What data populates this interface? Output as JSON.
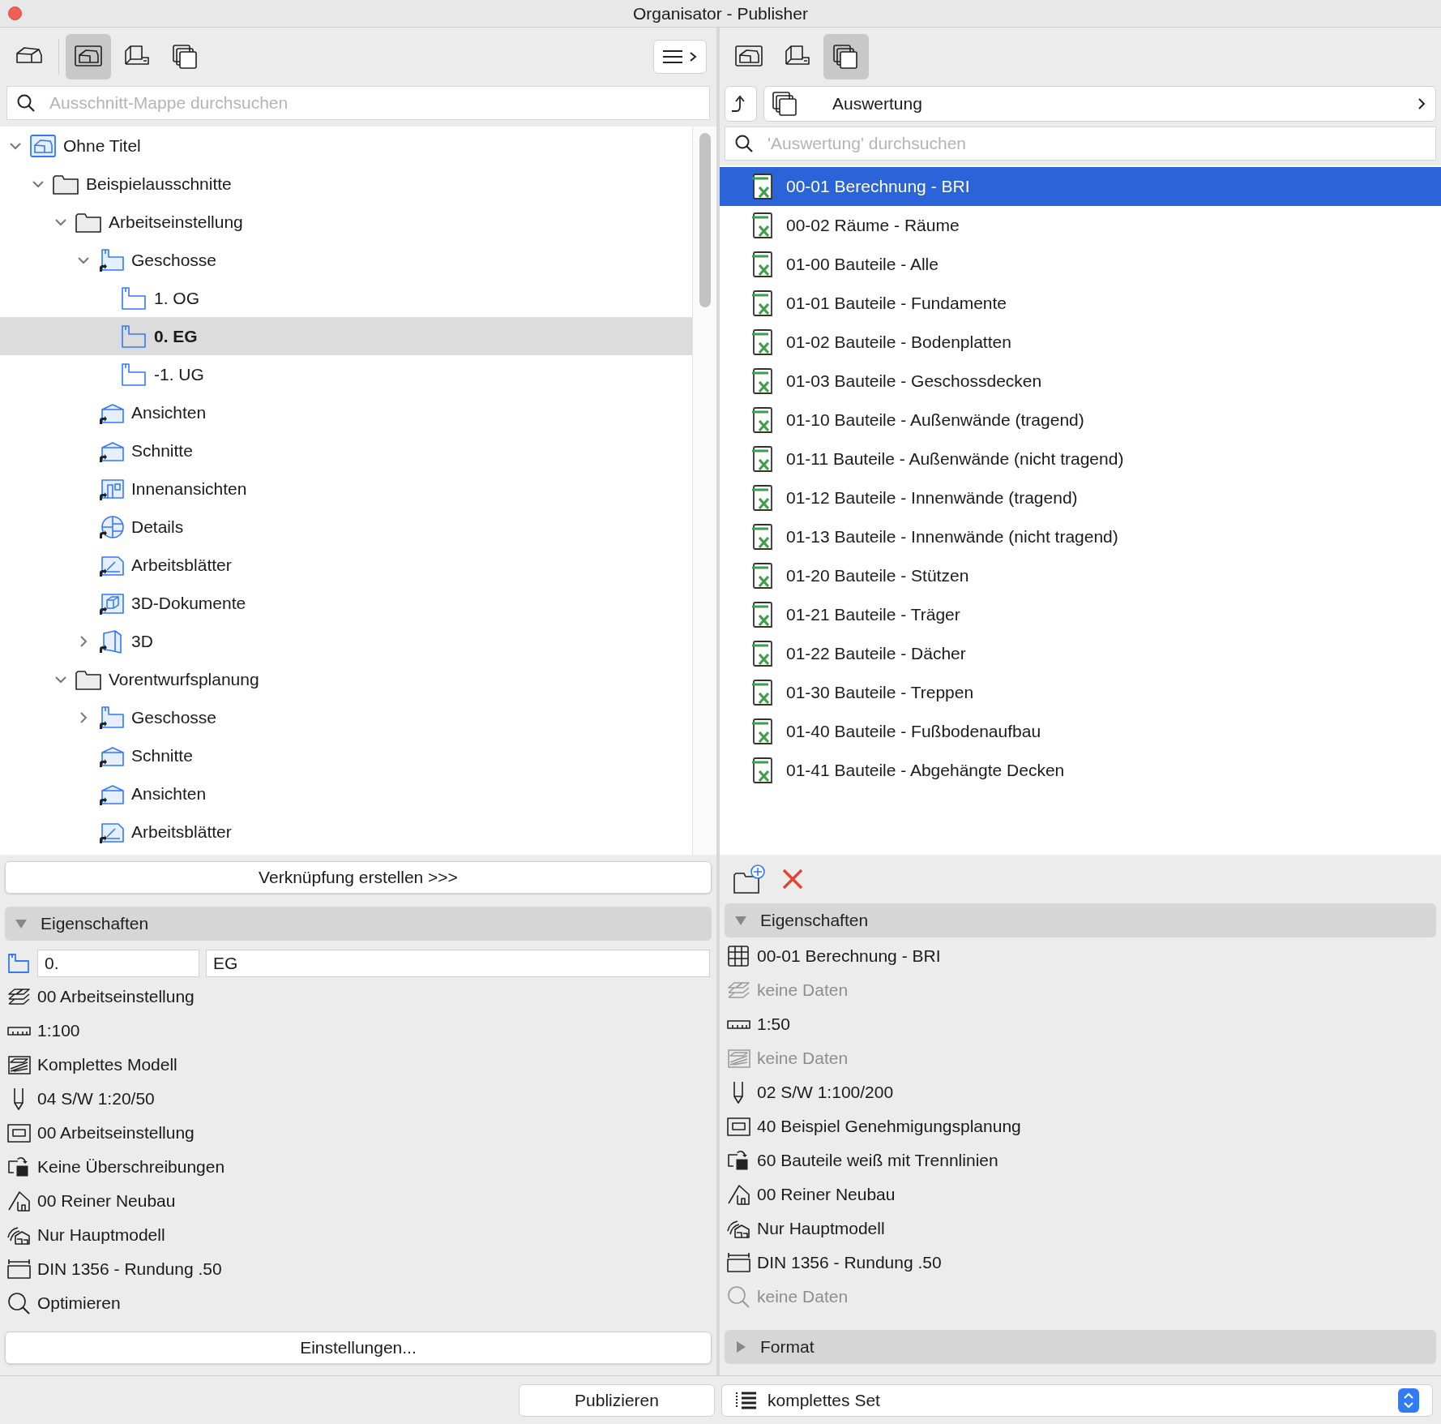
{
  "window": {
    "title": "Organisator - Publisher"
  },
  "left": {
    "toolbar": [
      {
        "kind": "project",
        "selected": false
      },
      {
        "kind": "views",
        "selected": true
      },
      {
        "kind": "layouts",
        "selected": false
      },
      {
        "kind": "sets",
        "selected": false
      }
    ],
    "search": {
      "placeholder": "Ausschnitt-Mappe durchsuchen"
    },
    "tree": [
      {
        "label": "Ohne Titel",
        "kind": "project",
        "expanded": true,
        "selected": false,
        "children": [
          {
            "label": "Beispielausschnitte",
            "kind": "folder",
            "expanded": true,
            "selected": false,
            "children": [
              {
                "label": "Arbeitseinstellung",
                "kind": "folder",
                "expanded": true,
                "selected": false,
                "children": [
                  {
                    "label": "Geschosse",
                    "kind": "stories",
                    "expanded": true,
                    "selected": false,
                    "children": [
                      {
                        "label": "1. OG",
                        "kind": "story",
                        "selected": false
                      },
                      {
                        "label": "0. EG",
                        "kind": "story",
                        "selected": true
                      },
                      {
                        "label": "-1. UG",
                        "kind": "story",
                        "selected": false
                      }
                    ]
                  },
                  {
                    "label": "Ansichten",
                    "kind": "elevations",
                    "selected": false
                  },
                  {
                    "label": "Schnitte",
                    "kind": "elevations",
                    "selected": false
                  },
                  {
                    "label": "Innenansichten",
                    "kind": "interior",
                    "selected": false
                  },
                  {
                    "label": "Details",
                    "kind": "details",
                    "selected": false
                  },
                  {
                    "label": "Arbeitsblätter",
                    "kind": "worksheets",
                    "selected": false
                  },
                  {
                    "label": "3D-Dokumente",
                    "kind": "documents3d",
                    "selected": false
                  },
                  {
                    "label": "3D",
                    "kind": "view3d",
                    "expanded": false,
                    "selected": false
                  }
                ]
              },
              {
                "label": "Vorentwurfsplanung",
                "kind": "folder",
                "expanded": true,
                "selected": false,
                "children": [
                  {
                    "label": "Geschosse",
                    "kind": "stories",
                    "expanded": false,
                    "selected": false
                  },
                  {
                    "label": "Schnitte",
                    "kind": "elevations",
                    "selected": false
                  },
                  {
                    "label": "Ansichten",
                    "kind": "elevations",
                    "selected": false
                  },
                  {
                    "label": "Arbeitsblätter",
                    "kind": "worksheets",
                    "selected": false
                  }
                ]
              }
            ]
          }
        ]
      }
    ],
    "link_button": "Verknüpfung erstellen >>>",
    "properties": {
      "title": "Eigenschaften",
      "expanded": true,
      "id_field": {
        "value": "0."
      },
      "name_field": {
        "value": "EG"
      },
      "rows": [
        {
          "kind": "layers",
          "text": "00 Arbeitseinstellung",
          "disabled": false
        },
        {
          "kind": "scale",
          "text": "1:100",
          "disabled": false
        },
        {
          "kind": "structure",
          "text": "Komplettes Modell",
          "disabled": false
        },
        {
          "kind": "pen",
          "text": "04 S/W 1:20/50",
          "disabled": false
        },
        {
          "kind": "mvo",
          "text": "00 Arbeitseinstellung",
          "disabled": false
        },
        {
          "kind": "override",
          "text": "Keine Überschreibungen",
          "disabled": false
        },
        {
          "kind": "renovation",
          "text": "00 Reiner Neubau",
          "disabled": false
        },
        {
          "kind": "model",
          "text": "Nur Hauptmodell",
          "disabled": false
        },
        {
          "kind": "dimension",
          "text": "DIN 1356 - Rundung .50",
          "disabled": false
        },
        {
          "kind": "zoom",
          "text": "Optimieren",
          "disabled": false
        }
      ]
    },
    "settings_button": "Einstellungen..."
  },
  "right": {
    "toolbar": [
      {
        "kind": "views",
        "selected": false
      },
      {
        "kind": "layouts",
        "selected": false
      },
      {
        "kind": "sets",
        "selected": true
      }
    ],
    "path": {
      "label": "Auswertung"
    },
    "search": {
      "placeholder": "'Auswertung' durchsuchen"
    },
    "items": [
      {
        "label": "00-01 Berechnung - BRI",
        "selected": true
      },
      {
        "label": "00-02 Räume - Räume",
        "selected": false
      },
      {
        "label": "01-00 Bauteile - Alle",
        "selected": false
      },
      {
        "label": "01-01 Bauteile - Fundamente",
        "selected": false
      },
      {
        "label": "01-02 Bauteile - Bodenplatten",
        "selected": false
      },
      {
        "label": "01-03 Bauteile - Geschossdecken",
        "selected": false
      },
      {
        "label": "01-10 Bauteile - Außenwände (tragend)",
        "selected": false
      },
      {
        "label": "01-11 Bauteile - Außenwände (nicht tragend)",
        "selected": false
      },
      {
        "label": "01-12 Bauteile - Innenwände (tragend)",
        "selected": false
      },
      {
        "label": "01-13 Bauteile - Innenwände (nicht tragend)",
        "selected": false
      },
      {
        "label": "01-20 Bauteile - Stützen",
        "selected": false
      },
      {
        "label": "01-21 Bauteile - Träger",
        "selected": false
      },
      {
        "label": "01-22 Bauteile - Dächer",
        "selected": false
      },
      {
        "label": "01-30 Bauteile - Treppen",
        "selected": false
      },
      {
        "label": "01-40 Bauteile - Fußbodenaufbau",
        "selected": false
      },
      {
        "label": "01-41 Bauteile - Abgehängte Decken",
        "selected": false
      }
    ],
    "properties": {
      "title": "Eigenschaften",
      "expanded": true,
      "rows": [
        {
          "kind": "table",
          "text": "00-01 Berechnung - BRI",
          "disabled": false
        },
        {
          "kind": "layers",
          "text": "keine Daten",
          "disabled": true
        },
        {
          "kind": "scale",
          "text": "1:50",
          "disabled": false
        },
        {
          "kind": "structure",
          "text": "keine Daten",
          "disabled": true
        },
        {
          "kind": "pen",
          "text": "02 S/W 1:100/200",
          "disabled": false
        },
        {
          "kind": "mvo",
          "text": "40 Beispiel Genehmigungsplanung",
          "disabled": false
        },
        {
          "kind": "override",
          "text": "60 Bauteile weiß mit Trennlinien",
          "disabled": false
        },
        {
          "kind": "renovation",
          "text": "00 Reiner Neubau",
          "disabled": false
        },
        {
          "kind": "model",
          "text": "Nur Hauptmodell",
          "disabled": false
        },
        {
          "kind": "dimension",
          "text": "DIN 1356 - Rundung .50",
          "disabled": false
        },
        {
          "kind": "zoom",
          "text": "keine Daten",
          "disabled": true
        }
      ]
    },
    "format": {
      "title": "Format",
      "expanded": false
    }
  },
  "bottom": {
    "publish_button": "Publizieren",
    "set_select": {
      "value": "komplettes Set"
    }
  }
}
